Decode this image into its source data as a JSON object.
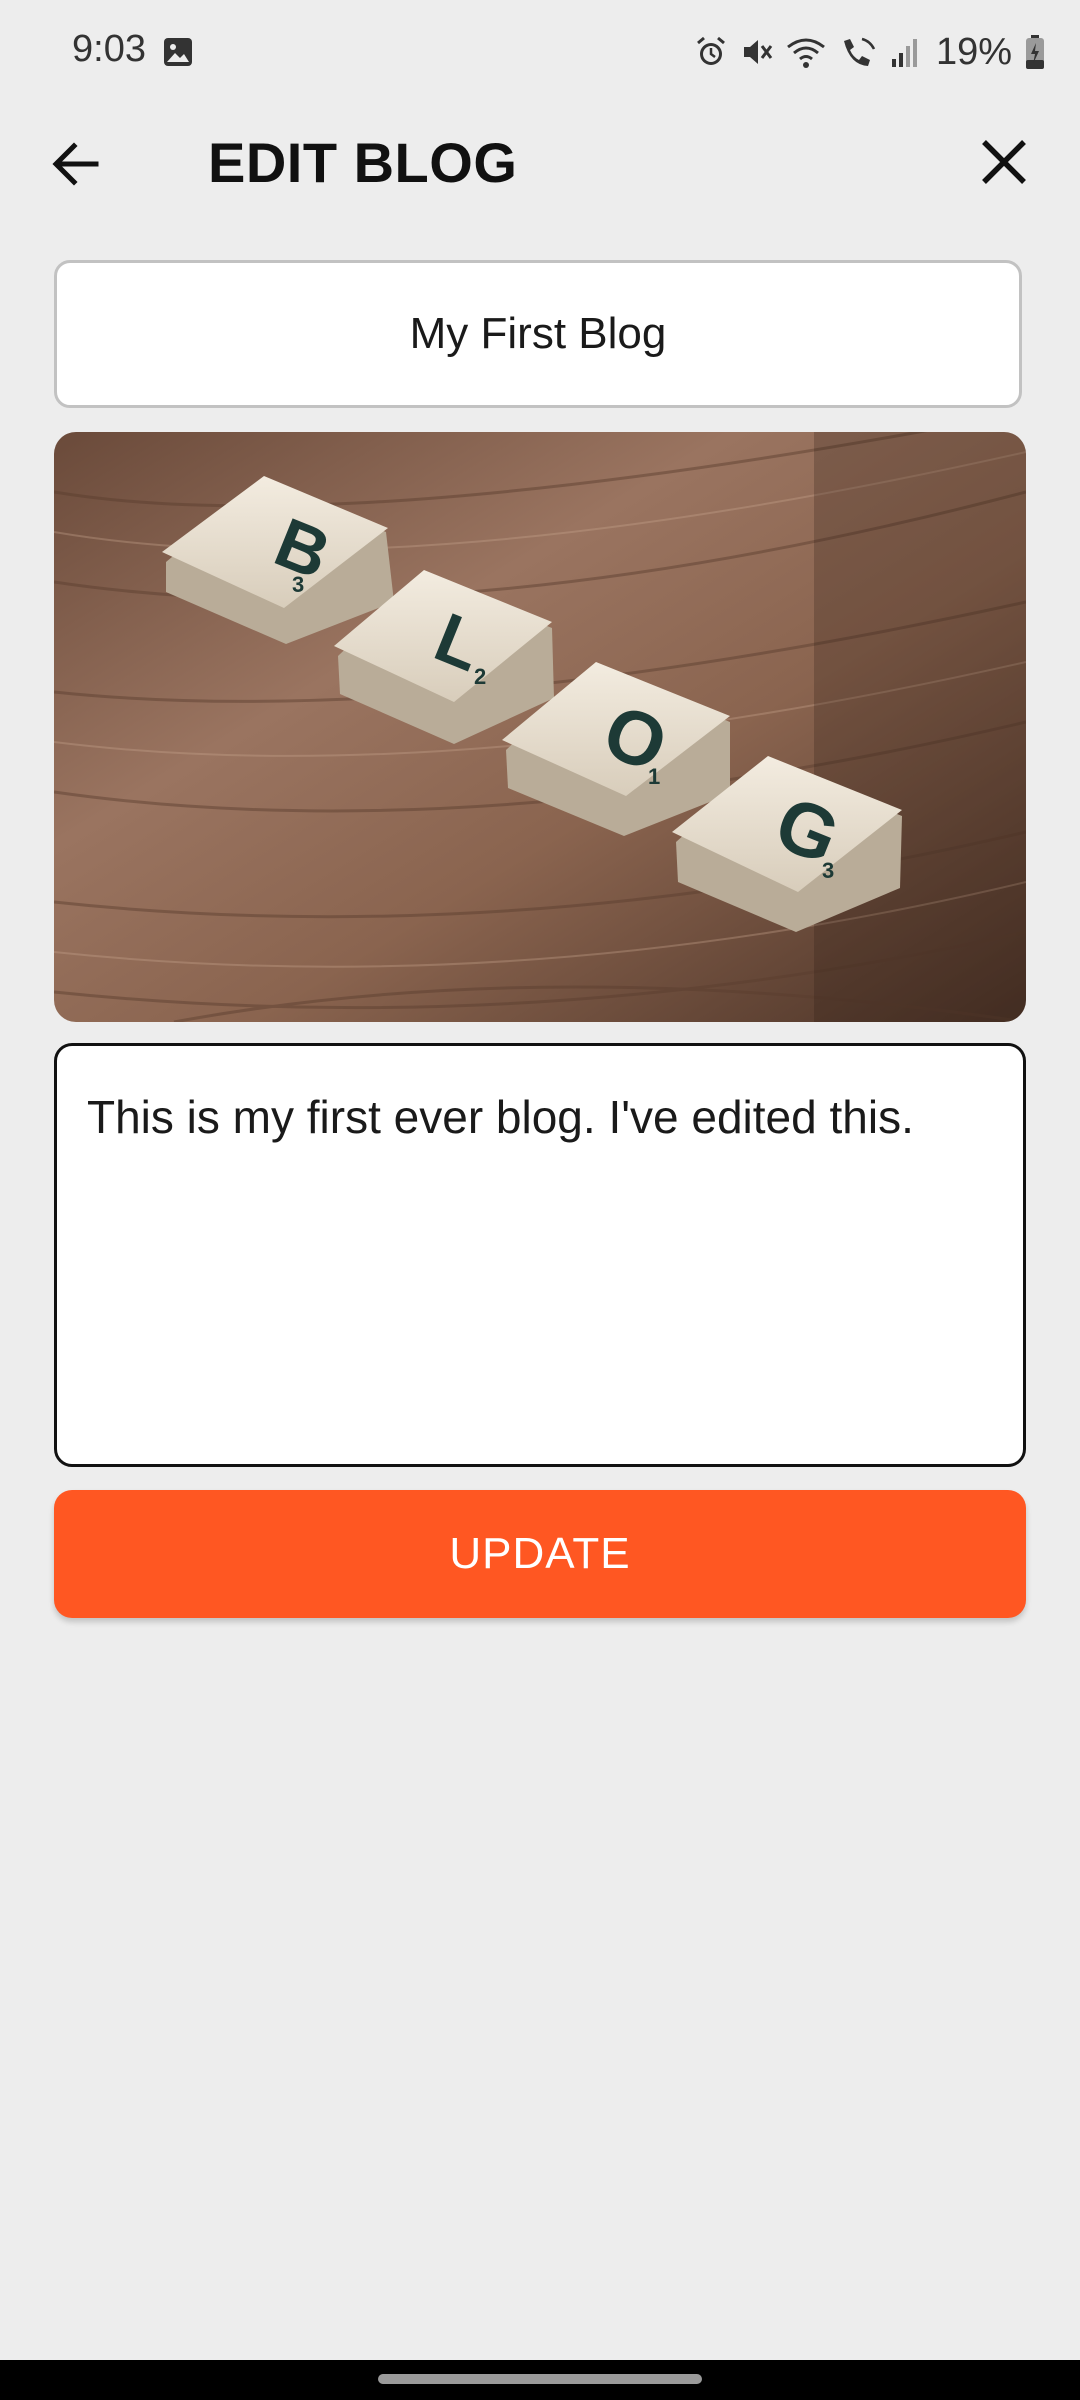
{
  "status_bar": {
    "time": "9:03",
    "battery_percent": "19%",
    "icons": [
      "image-icon",
      "alarm-icon",
      "mute-icon",
      "wifi-icon",
      "wifi-call-icon",
      "signal-icon",
      "battery-charging-icon"
    ]
  },
  "header": {
    "title": "EDIT BLOG",
    "back_icon": "arrow-left-icon",
    "close_icon": "close-icon"
  },
  "form": {
    "blog_title": "My First Blog",
    "image_tiles": [
      "B",
      "L",
      "O",
      "G"
    ],
    "tile_numbers": [
      "3",
      "2",
      "1",
      "3"
    ],
    "blog_body": "This is my first ever blog. I've edited this.",
    "update_label": "UPDATE"
  },
  "colors": {
    "accent": "#ff5722",
    "background": "#ededed"
  }
}
